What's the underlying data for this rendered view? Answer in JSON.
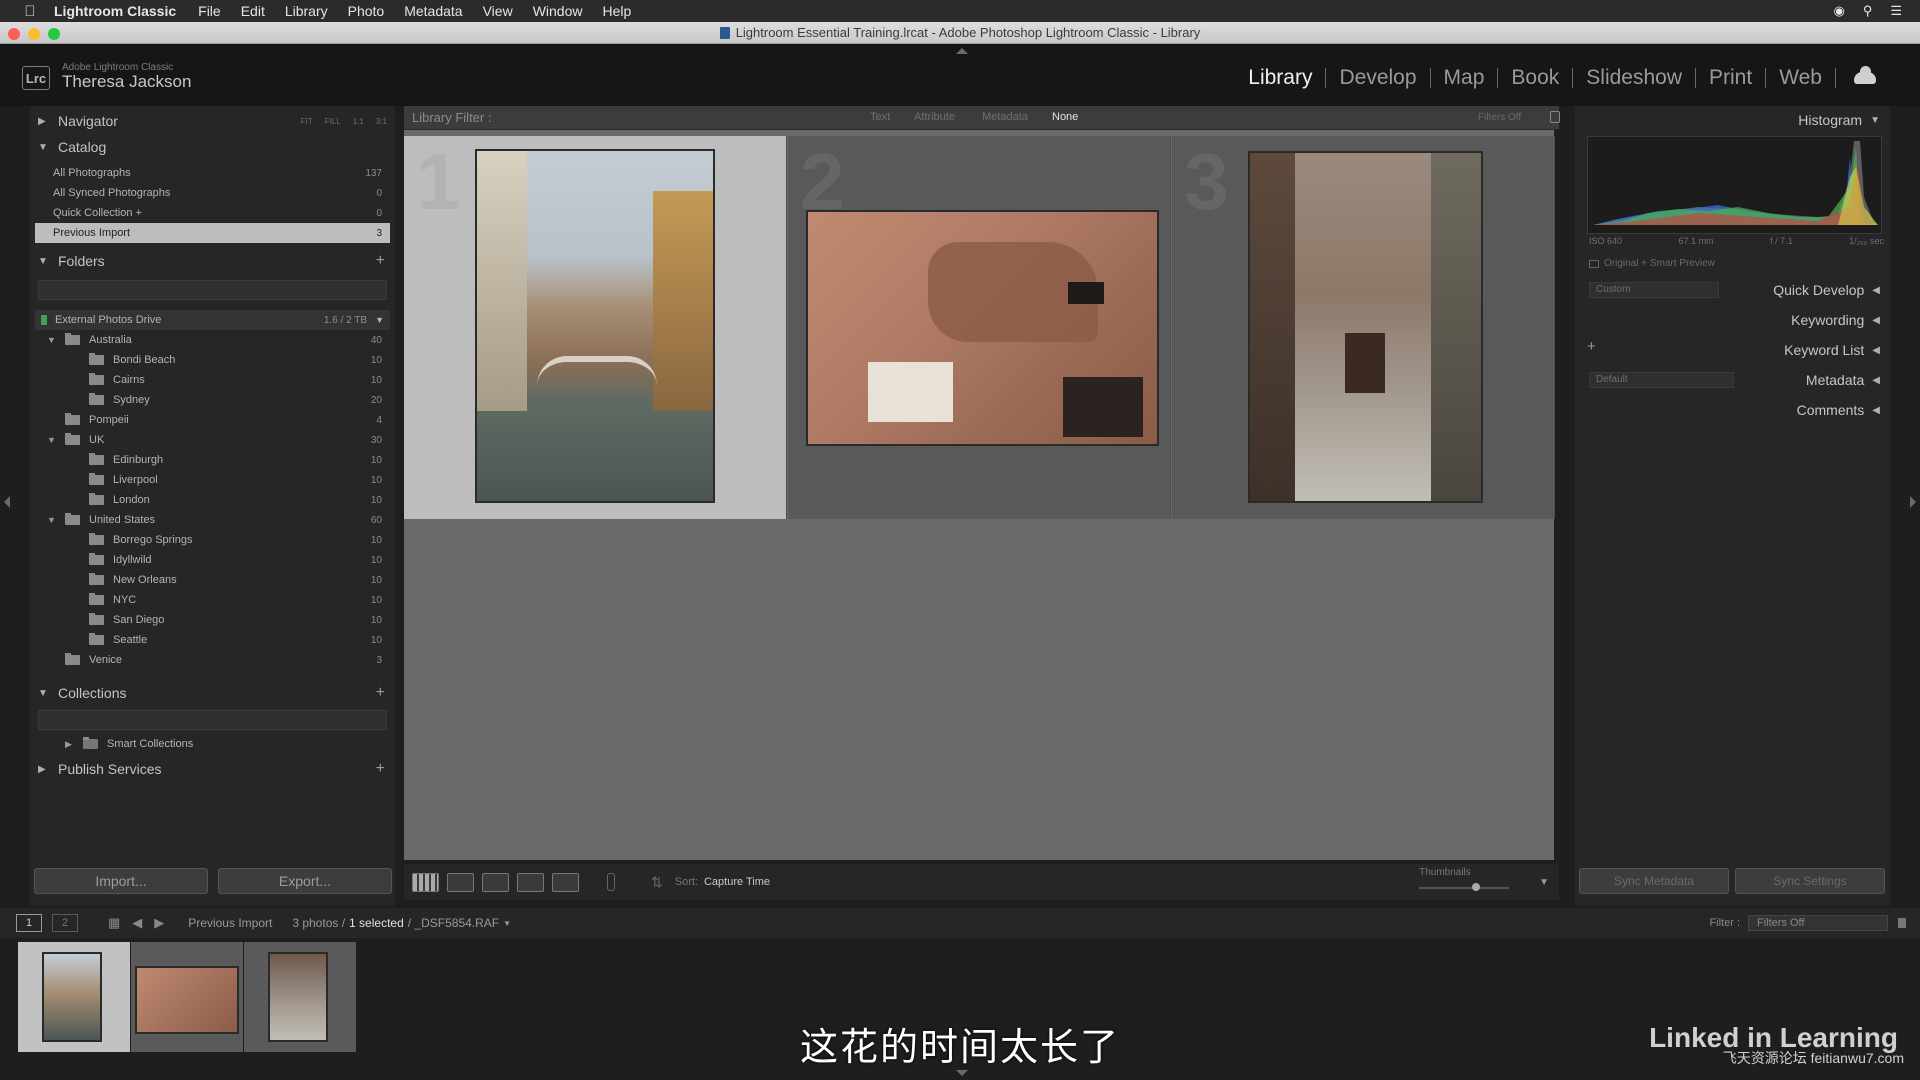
{
  "menubar": {
    "app_name": "Lightroom Classic",
    "items": [
      "File",
      "Edit",
      "Library",
      "Photo",
      "Metadata",
      "View",
      "Window",
      "Help"
    ]
  },
  "window": {
    "title": "Lightroom Essential Training.lrcat - Adobe Photoshop Lightroom Classic - Library"
  },
  "identity": {
    "small": "Adobe Lightroom Classic",
    "user": "Theresa Jackson",
    "badge": "Lrc"
  },
  "modules": [
    "Library",
    "Develop",
    "Map",
    "Book",
    "Slideshow",
    "Print",
    "Web"
  ],
  "left": {
    "navigator": {
      "label": "Navigator",
      "zoom": [
        "FIT",
        "FILL",
        "1:1",
        "3:1"
      ]
    },
    "catalog": {
      "label": "Catalog",
      "items": [
        {
          "label": "All Photographs",
          "count": "137"
        },
        {
          "label": "All Synced Photographs",
          "count": "0"
        },
        {
          "label": "Quick Collection +",
          "count": "0"
        },
        {
          "label": "Previous Import",
          "count": "3"
        }
      ]
    },
    "folders": {
      "label": "Folders",
      "volume": {
        "label": "External Photos Drive",
        "count": "1.6 / 2 TB"
      },
      "items": [
        {
          "label": "Australia",
          "count": "40"
        },
        {
          "label": "Bondi Beach",
          "count": "10"
        },
        {
          "label": "Cairns",
          "count": "10"
        },
        {
          "label": "Sydney",
          "count": "20"
        },
        {
          "label": "Pompeii",
          "count": "4"
        },
        {
          "label": "UK",
          "count": "30"
        },
        {
          "label": "Edinburgh",
          "count": "10"
        },
        {
          "label": "Liverpool",
          "count": "10"
        },
        {
          "label": "London",
          "count": "10"
        },
        {
          "label": "United States",
          "count": "60"
        },
        {
          "label": "Borrego Springs",
          "count": "10"
        },
        {
          "label": "Idyllwild",
          "count": "10"
        },
        {
          "label": "New Orleans",
          "count": "10"
        },
        {
          "label": "NYC",
          "count": "10"
        },
        {
          "label": "San Diego",
          "count": "10"
        },
        {
          "label": "Seattle",
          "count": "10"
        },
        {
          "label": "Venice",
          "count": "3"
        }
      ]
    },
    "collections": {
      "label": "Collections",
      "items": [
        {
          "label": "Smart Collections"
        }
      ]
    },
    "publish": {
      "label": "Publish Services"
    },
    "import_label": "Import...",
    "export_label": "Export..."
  },
  "filter": {
    "label": "Library Filter :",
    "tabs": [
      "Text",
      "Attribute",
      "Metadata",
      "None"
    ],
    "filters_off": "Filters Off"
  },
  "grid": {
    "cells": [
      {
        "index": "1"
      },
      {
        "index": "2"
      },
      {
        "index": "3"
      }
    ],
    "selected_index": 1
  },
  "toolbar": {
    "sort_label": "Sort:",
    "sort_value": "Capture Time",
    "thumbnails_label": "Thumbnails",
    "thumbnails_value": 0.65
  },
  "right": {
    "histogram": {
      "label": "Histogram",
      "iso": "ISO 640",
      "focal": "67.1 mm",
      "aperture": "f / 7.1",
      "shutter": "1/₂₅₀ sec"
    },
    "preview_label": "Original + Smart Preview",
    "quick_develop": {
      "label": "Quick Develop",
      "preset": "Custom"
    },
    "keywording": "Keywording",
    "keyword_list": "Keyword List",
    "metadata": {
      "label": "Metadata",
      "preset": "Default"
    },
    "comments": "Comments",
    "sync_metadata": "Sync Metadata",
    "sync_settings": "Sync Settings"
  },
  "filmbar": {
    "source": "Previous Import",
    "count": "3 photos /",
    "selected": "1 selected",
    "file": "/ _DSF5854.RAF",
    "filter_label": "Filter :",
    "filter_value": "Filters Off",
    "page1": "1",
    "page2": "2"
  },
  "subtitle": "这花的时间太长了",
  "watermark": {
    "brand": "Linked in Learning",
    "site": "飞天资源论坛 feitianwu7.com"
  }
}
